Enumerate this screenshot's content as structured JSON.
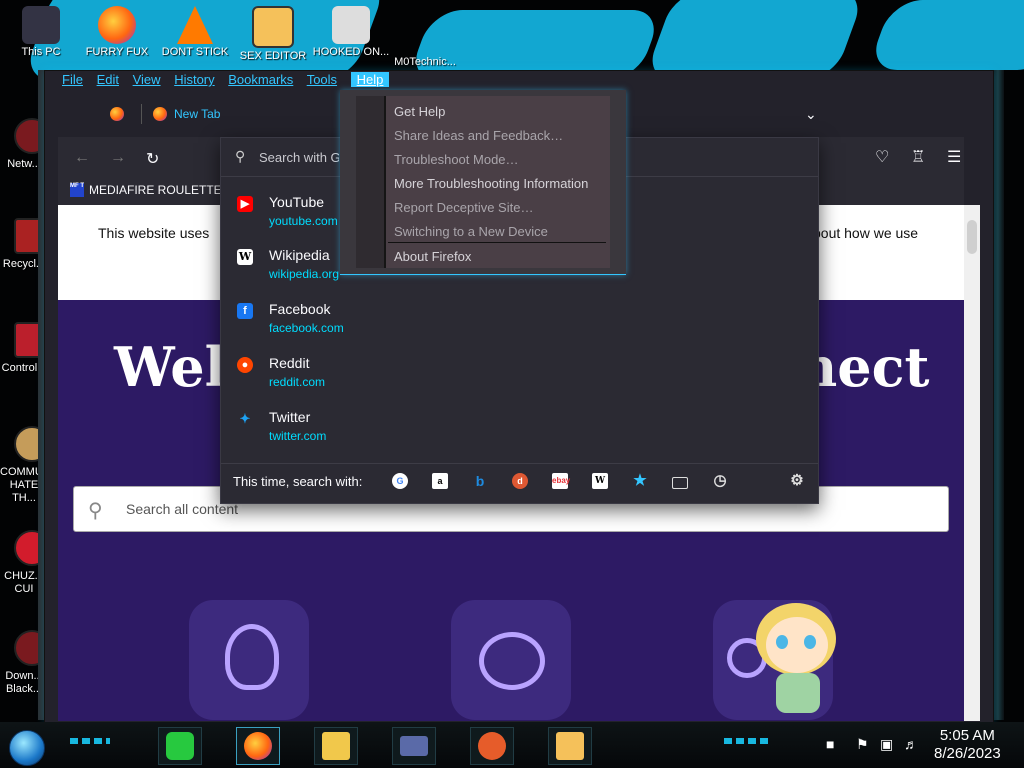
{
  "desktop": {
    "icons": [
      {
        "label": "This PC"
      },
      {
        "label": "FURRY FUX"
      },
      {
        "label": "DONT STICK"
      },
      {
        "label": "SEX EDITOR"
      },
      {
        "label": "HOOKED ON..."
      },
      {
        "label": "M0Technic..."
      }
    ],
    "side_icons": [
      {
        "label": "Netw..."
      },
      {
        "label": "Recycl..."
      },
      {
        "label": "Control..."
      },
      {
        "label": "COMMU... HATE TH..."
      },
      {
        "label": "CHUZ... CUI"
      },
      {
        "label": "Down... Black..."
      }
    ]
  },
  "menubar": {
    "items": [
      "File",
      "Edit",
      "View",
      "History",
      "Bookmarks",
      "Tools",
      "Help"
    ]
  },
  "tabs": {
    "new_tab_label": "New Tab"
  },
  "bookmarks": {
    "item": "MEDIAFIRE ROULETTER",
    "favicon_text": "MF T"
  },
  "page": {
    "cookie_left": "This website uses",
    "cookie_right": "bout how we use",
    "hero_left": "Welc",
    "hero_right": "nect",
    "search_placeholder": "Search all content"
  },
  "urlbar": {
    "search_text": "Search with G",
    "results": [
      {
        "title": "YouTube",
        "url": "youtube.com",
        "icon": "youtube-icon",
        "color": "#ff0000"
      },
      {
        "title": "Wikipedia",
        "url": "wikipedia.org",
        "icon": "wikipedia-icon",
        "color": "#ffffff"
      },
      {
        "title": "Facebook",
        "url": "facebook.com",
        "icon": "facebook-icon",
        "color": "#1877f2"
      },
      {
        "title": "Reddit",
        "url": "reddit.com",
        "icon": "reddit-icon",
        "color": "#ff4500"
      },
      {
        "title": "Twitter",
        "url": "twitter.com",
        "icon": "twitter-icon",
        "color": "#1da1f2"
      }
    ],
    "oneoff_label": "This time, search with:",
    "engines": [
      "google",
      "amazon",
      "bing",
      "duckduckgo",
      "ebay",
      "wikipedia",
      "bookmarks",
      "tabs",
      "history"
    ]
  },
  "help_menu": {
    "items": [
      "Get Help",
      "Share Ideas and Feedback…",
      "Troubleshoot Mode…",
      "More Troubleshooting Information",
      "Report Deceptive Site…",
      "Switching to a New Device",
      "About Firefox"
    ]
  },
  "taskbar": {
    "time": "5:05 AM",
    "date": "8/26/2023"
  }
}
